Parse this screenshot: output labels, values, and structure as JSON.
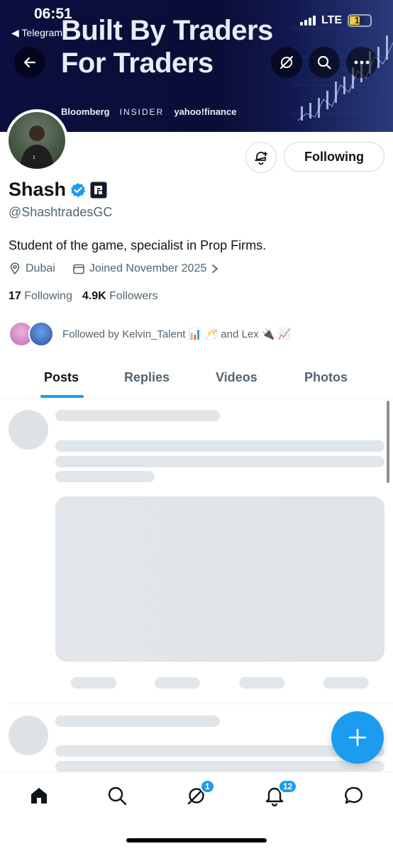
{
  "status_bar": {
    "time": "06:51",
    "back_app": "◀ Telegram",
    "network": "LTE",
    "battery": "18"
  },
  "banner": {
    "headline_line1": "Built By Traders",
    "headline_line2": "For Traders",
    "logos": [
      "Bloomberg",
      "INSIDER",
      "yahoo!finance"
    ]
  },
  "profile": {
    "name": "Shash",
    "handle": "@ShashtradesGC",
    "bio": "Student of the game, specialist in Prop Firms.",
    "location": "Dubai",
    "joined": "Joined November 2025",
    "following_count": "17",
    "following_label": "Following",
    "followers_count": "4.9K",
    "followers_label": "Followers",
    "followed_by": "Followed by Kelvin_Talent 📊 🥂 and Lex 🔌 📈",
    "follow_button": "Following"
  },
  "tabs": [
    {
      "label": "Posts",
      "active": true
    },
    {
      "label": "Replies",
      "active": false
    },
    {
      "label": "Videos",
      "active": false
    },
    {
      "label": "Photos",
      "active": false
    }
  ],
  "nav": {
    "grok_badge": "1",
    "notifications_badge": "12"
  },
  "colors": {
    "accent": "#1d9bf0",
    "banner_bg": "#0b0f3f",
    "verified": "#1d9bf0"
  }
}
